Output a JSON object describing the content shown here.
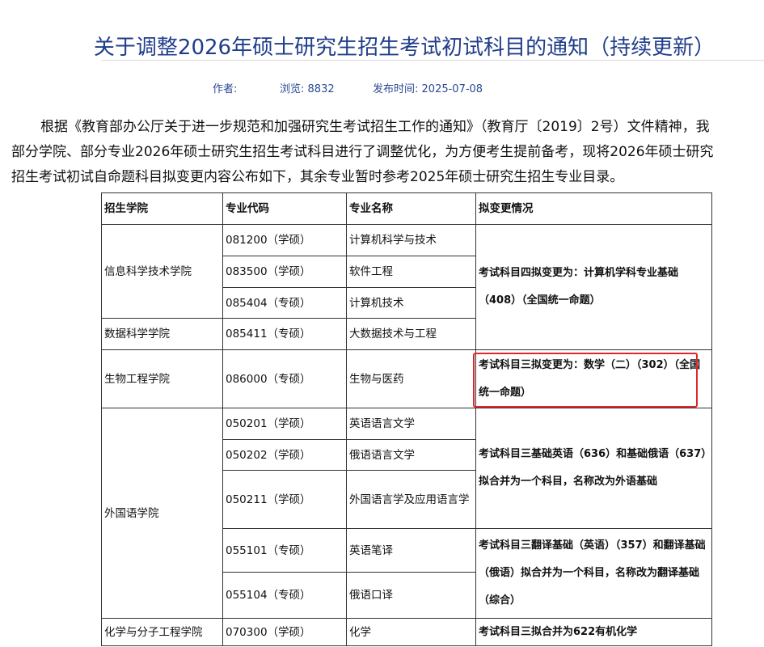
{
  "article": {
    "title": "关于调整2026年硕士研究生招生考试初试科目的通知（持续更新）",
    "meta": {
      "author_label": "作者:",
      "views_label": "浏览:",
      "views": "8832",
      "date_label": "发布时间:",
      "date": "2025-07-08"
    },
    "body": [
      "根据《教育部办公厅关于进一步规范和加强研究生考试招生工作的通知》（教育厅〔2019〕2号）文件精神，我",
      "部分学院、部分专业2026年硕士研究生招生考试科目进行了调整优化，为方便考生提前备考，现将2026年硕士研究",
      "招生考试初试自命题科目拟变更内容公布如下，其余专业暂时参考2025年硕士研究生招生专业目录。"
    ]
  },
  "table": {
    "headers": [
      "招生学院",
      "专业代码",
      "专业名称",
      "拟变更情况"
    ],
    "colleges": [
      "信息科学技术学院",
      "数据科学学院",
      "生物工程学院",
      "外国语学院",
      "化学与分子工程学院"
    ],
    "rows": [
      {
        "code": "081200（学硕）",
        "name": "计算机科学与技术"
      },
      {
        "code": "083500（学硕）",
        "name": "软件工程"
      },
      {
        "code": "085404（专硕）",
        "name": "计算机技术"
      },
      {
        "code": "085411（专硕）",
        "name": "大数据技术与工程"
      },
      {
        "code": "086000（专硕）",
        "name": "生物与医药"
      },
      {
        "code": "050201（学硕）",
        "name": "英语语言文学"
      },
      {
        "code": "050202（学硕）",
        "name": "俄语语言文学"
      },
      {
        "code": "050211（学硕）",
        "name": "外国语言学及应用语言学"
      },
      {
        "code": "055101（专硕）",
        "name": "英语笔译"
      },
      {
        "code": "055104（专硕）",
        "name": "俄语口译"
      },
      {
        "code": "070300（学硕）",
        "name": "化学"
      }
    ],
    "changes": [
      "考试科目四拟变更为：计算机学科专业基础（408）（全国统一命题）",
      "考试科目三拟变更为：数学（二）（302）（全国统一命题）",
      "考试科目三基础英语（636）和基础俄语（637）拟合并为一个科目，名称改为外语基础",
      "考试科目三翻译基础（英语）（357）和翻译基础（俄语）拟合并为一个科目，名称改为翻译基础（综合）",
      "考试科目三拟合并为622有机化学"
    ]
  },
  "highlight_color": "#e0262a",
  "title_color": "#1f3d8a"
}
